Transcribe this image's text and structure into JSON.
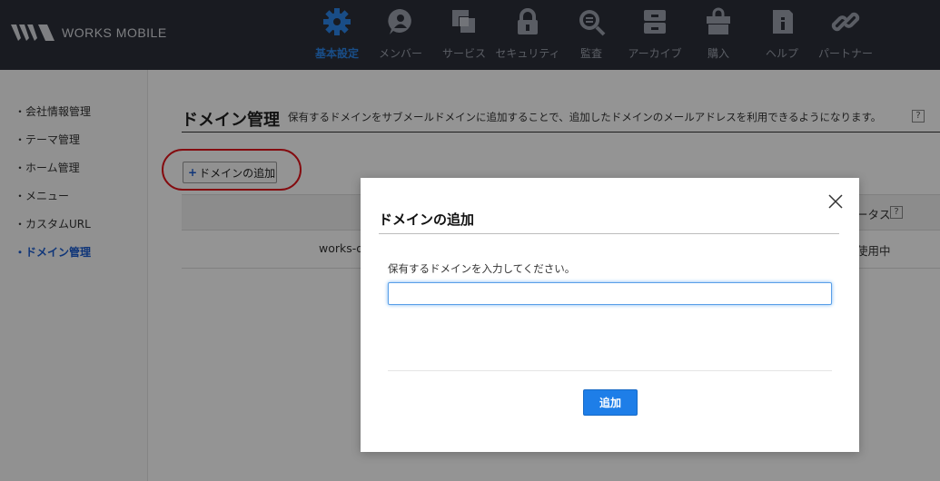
{
  "header": {
    "logo_text": "WORKS MOBILE",
    "nav": [
      {
        "label": "基本設定",
        "icon": "gear-icon",
        "active": true
      },
      {
        "label": "メンバー",
        "icon": "member-icon"
      },
      {
        "label": "サービス",
        "icon": "service-icon"
      },
      {
        "label": "セキュリティ",
        "icon": "lock-icon"
      },
      {
        "label": "監査",
        "icon": "audit-search-icon"
      },
      {
        "label": "アーカイブ",
        "icon": "archive-icon"
      },
      {
        "label": "購入",
        "icon": "shopping-bag-icon"
      },
      {
        "label": "ヘルプ",
        "icon": "help-book-icon"
      },
      {
        "label": "パートナー",
        "icon": "link-icon"
      }
    ],
    "active_color": "#2b86e8"
  },
  "sidebar": {
    "items": [
      {
        "label": "・会社情報管理"
      },
      {
        "label": "・テーマ管理"
      },
      {
        "label": "・ホーム管理"
      },
      {
        "label": "・メニュー"
      },
      {
        "label": "・カスタムURL"
      },
      {
        "label": "・ドメイン管理",
        "active": true
      }
    ]
  },
  "main": {
    "title": "ドメイン管理",
    "description": "保有するドメインをサブメールドメインに追加することで、追加したドメインのメールアドレスを利用できるようになります。",
    "help": "?",
    "add_button_plus": "+",
    "add_button_label": "ドメインの追加",
    "table": {
      "status_header": "ータス",
      "status_help": "?",
      "row_domain": "works-d",
      "row_status": "使用中"
    }
  },
  "modal": {
    "title": "ドメインの追加",
    "label": "保有するドメインを入力してください。",
    "input_value": "",
    "submit_label": "追加"
  },
  "colors": {
    "header_bg": "#2b2f3a",
    "accent": "#1e7ee8",
    "highlight_circle": "#e4141b"
  }
}
